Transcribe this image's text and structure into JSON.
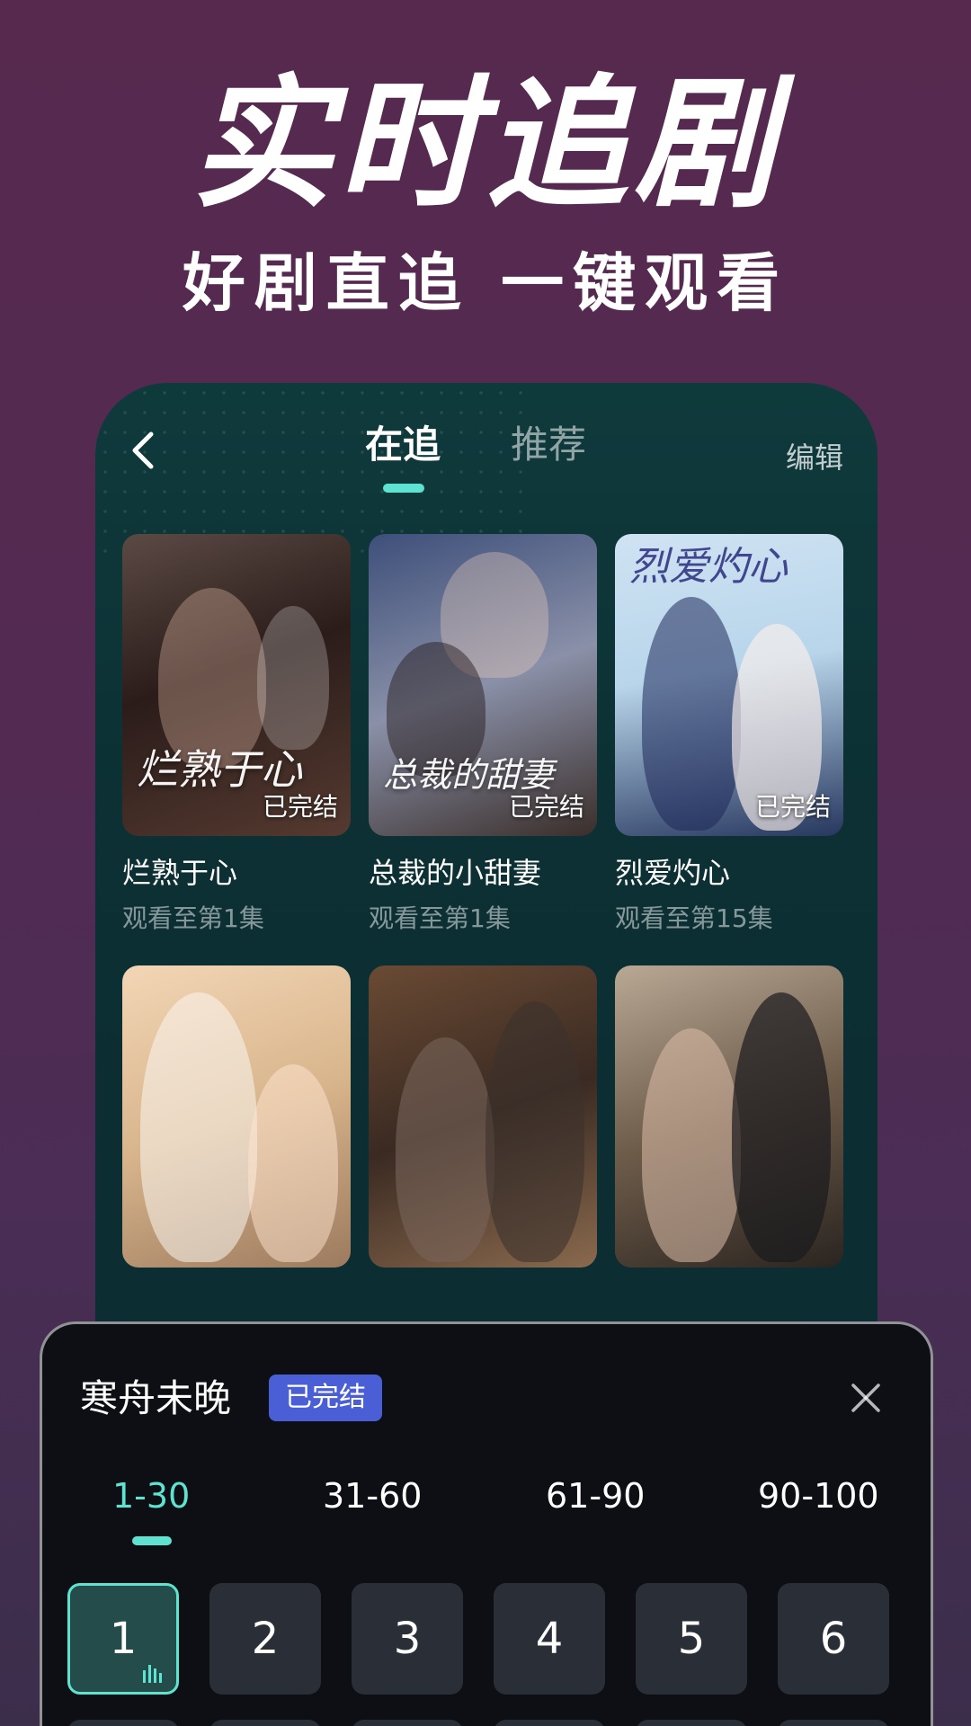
{
  "promo": {
    "title": "实时追剧",
    "subtitle": "好剧直追 一键观看"
  },
  "header": {
    "tabs": [
      {
        "label": "在追",
        "active": true
      },
      {
        "label": "推荐",
        "active": false
      }
    ],
    "edit_label": "编辑",
    "accent_color": "#5ee3d0"
  },
  "dramas": [
    {
      "title": "烂熟于心",
      "progress": "观看至第1集",
      "status": "已完结",
      "poster_text": "烂熟于心"
    },
    {
      "title": "总裁的小甜妻",
      "progress": "观看至第1集",
      "status": "已完结",
      "poster_text": "总裁的甜妻"
    },
    {
      "title": "烈爱灼心",
      "progress": "观看至第15集",
      "status": "已完结",
      "poster_text": "烈爱灼心"
    },
    {
      "title": "",
      "progress": "",
      "status": "",
      "poster_text": ""
    },
    {
      "title": "",
      "progress": "",
      "status": "",
      "poster_text": ""
    },
    {
      "title": "",
      "progress": "",
      "status": "",
      "poster_text": ""
    }
  ],
  "episode_sheet": {
    "title": "寒舟未晚",
    "badge": "已完结",
    "ranges": [
      "1-30",
      "31-60",
      "61-90",
      "90-100"
    ],
    "active_range": "1-30",
    "episodes": [
      "1",
      "2",
      "3",
      "4",
      "5",
      "6"
    ],
    "current_episode": "1",
    "badge_color": "#4a5fd6"
  }
}
